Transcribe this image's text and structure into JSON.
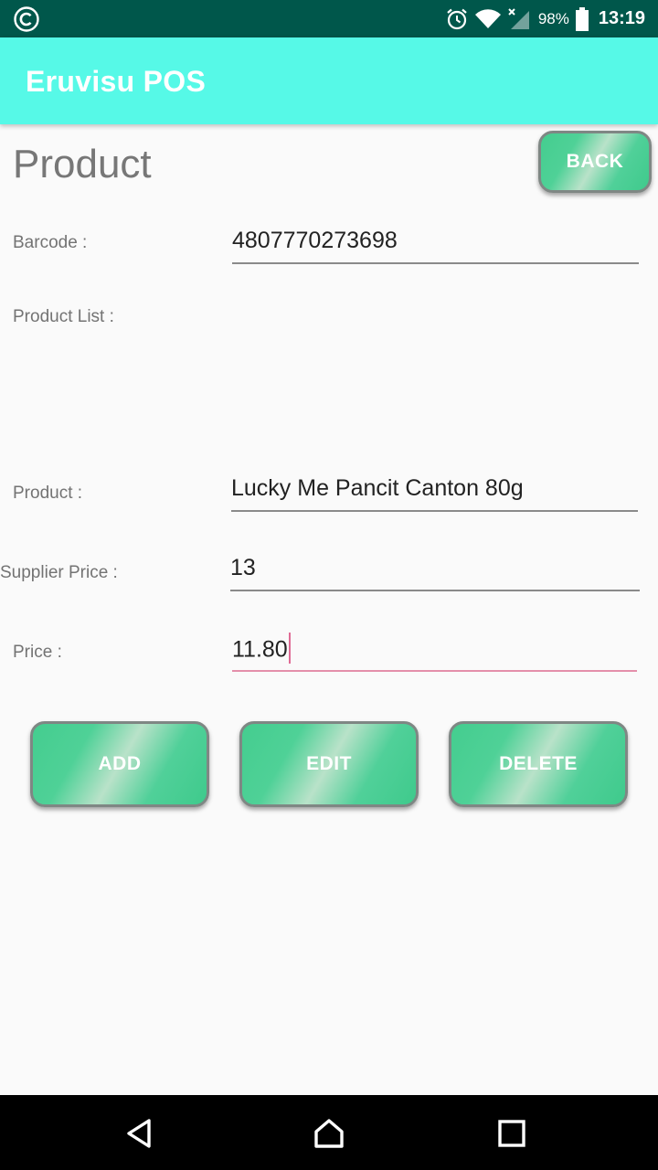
{
  "status_bar": {
    "battery_percent": "98%",
    "time": "13:19",
    "icons": [
      "copyright-icon",
      "alarm-icon",
      "wifi-icon",
      "signal-icon",
      "battery-icon"
    ]
  },
  "app_bar": {
    "title": "Eruvisu POS",
    "color": "#56f9e7"
  },
  "page": {
    "title": "Product",
    "back_label": "BACK"
  },
  "form": {
    "barcode_label": "Barcode :",
    "barcode_value": "4807770273698",
    "product_list_label": "Product List :",
    "product_label": "Product :",
    "product_value": "Lucky Me Pancit Canton 80g",
    "supplier_price_label": "Supplier Price :",
    "supplier_price_value": "13",
    "price_label": "Price :",
    "price_value": "11.80"
  },
  "actions": {
    "add_label": "ADD",
    "edit_label": "EDIT",
    "delete_label": "DELETE"
  },
  "colors": {
    "status_bar": "#00574b",
    "button_green": "#44cd8f",
    "focus_underline": "#e48fab"
  },
  "nav_bar": {
    "icons": [
      "back-triangle-icon",
      "home-icon",
      "recent-apps-icon"
    ]
  }
}
